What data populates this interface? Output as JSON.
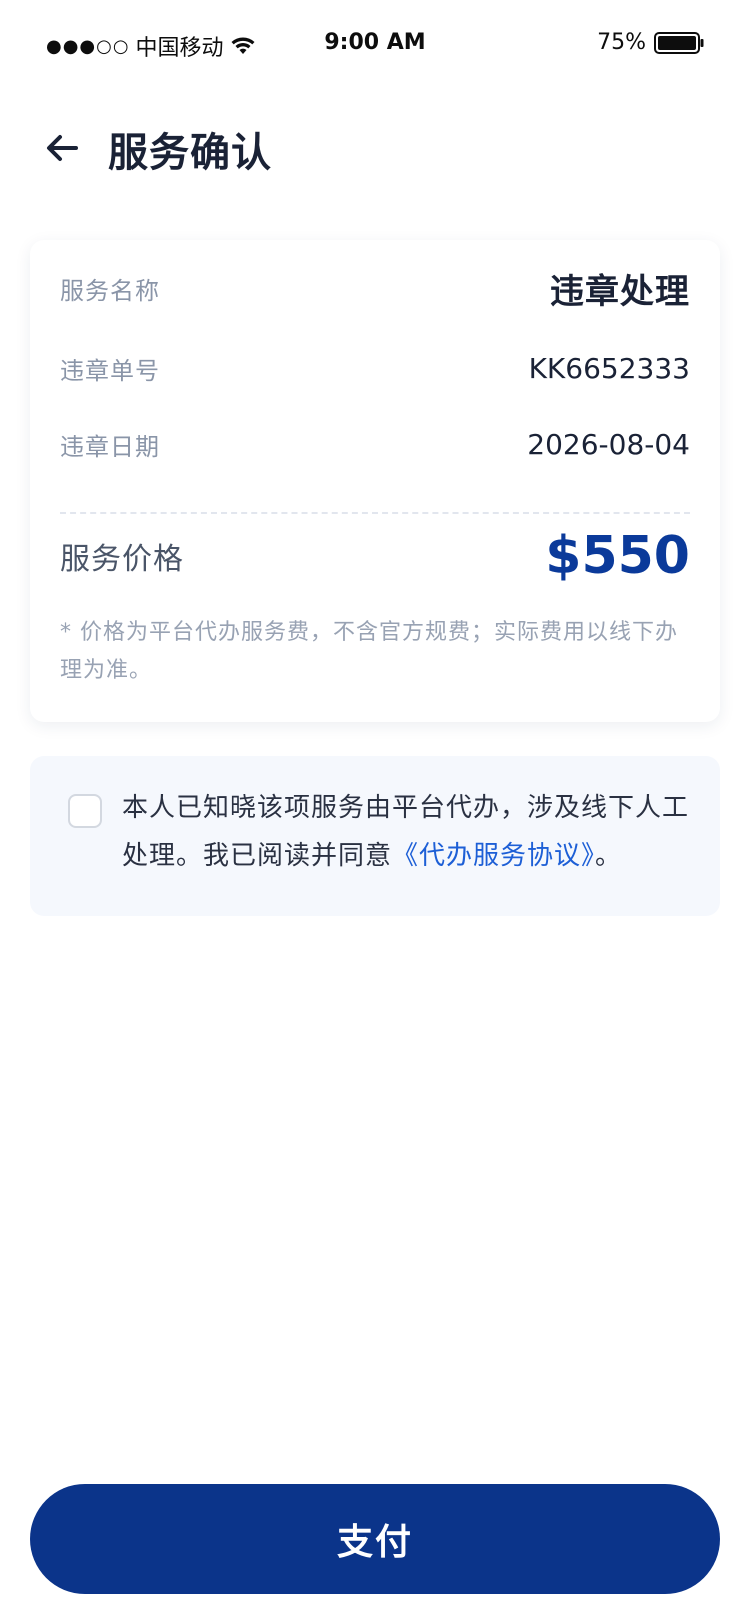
{
  "status_bar": {
    "signal": "●●●○○",
    "carrier": "中国移动",
    "time": "9:00 AM",
    "battery": "75%"
  },
  "header": {
    "title": "服务确认"
  },
  "card": {
    "service_name_label": "服务名称",
    "service_name_value": "违章处理",
    "violation_no_label": "违章单号",
    "violation_no_value": "KK6652333",
    "violation_date_label": "违章日期",
    "violation_date_value": "2026-08-04",
    "price_label": "服务价格",
    "price_value": "$550",
    "note": "* 价格为平台代办服务费，不含官方规费；实际费用以线下办理为准。"
  },
  "agreement": {
    "text_before": "本人已知晓该项服务由平台代办，涉及线下人工处理。我已阅读并同意",
    "link_text": "《代办服务协议》",
    "text_after": "。"
  },
  "pay_button": {
    "label": "支付"
  },
  "colors": {
    "primary": "#0b348a",
    "price": "#0b3a9a",
    "link": "#1d5fd6"
  }
}
